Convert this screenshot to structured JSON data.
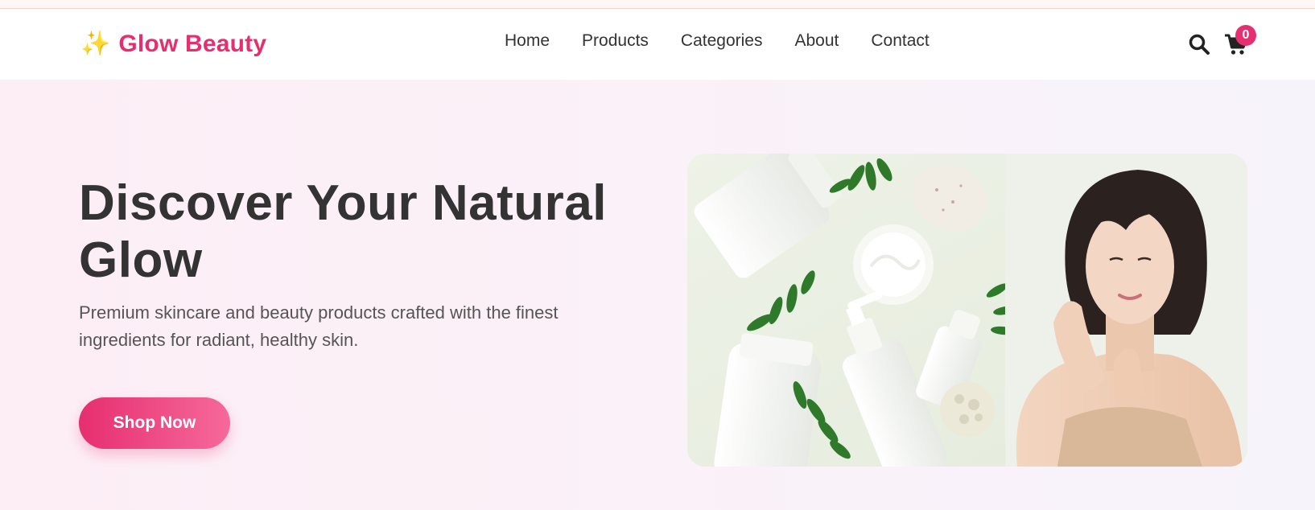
{
  "header": {
    "logo_icon": "sparkles-icon",
    "brand": "Glow Beauty",
    "nav": [
      "Home",
      "Products",
      "Categories",
      "About",
      "Contact"
    ],
    "cart_count": "0"
  },
  "hero": {
    "title": "Discover Your Natural Glow",
    "subtitle": "Premium skincare and beauty products crafted with the finest ingredients for radiant, healthy skin.",
    "cta": "Shop Now"
  },
  "colors": {
    "brand": "#e62f6e",
    "text_dark": "#333333",
    "text_muted": "#555555",
    "hero_bg": "#fdeef6",
    "image_bg": "#e9efe0"
  }
}
